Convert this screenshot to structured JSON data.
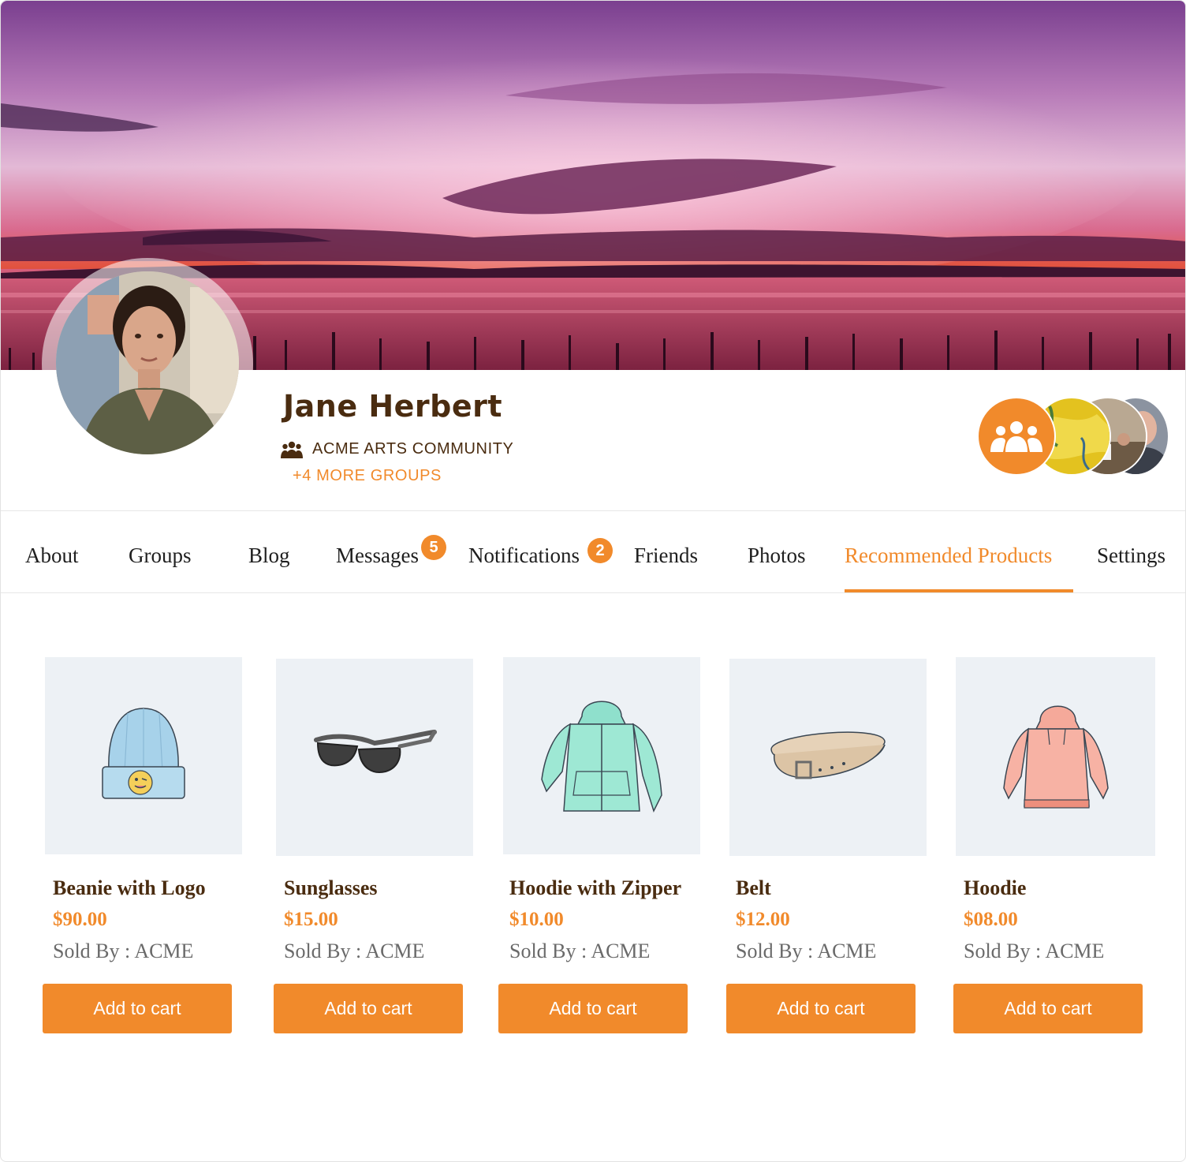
{
  "profile": {
    "name": "Jane Herbert",
    "group": "ACME ARTS COMMUNITY",
    "more_groups": "+4 MORE GROUPS"
  },
  "tabs": [
    {
      "label": "About"
    },
    {
      "label": "Groups"
    },
    {
      "label": "Blog"
    },
    {
      "label": "Messages",
      "badge": "5"
    },
    {
      "label": "Notifications",
      "badge": "2"
    },
    {
      "label": "Friends"
    },
    {
      "label": "Photos"
    },
    {
      "label": "Recommended Products",
      "active": true
    },
    {
      "label": "Settings"
    }
  ],
  "products": [
    {
      "name": "Beanie with Logo",
      "price": "$90.00",
      "seller": "Sold By : ACME",
      "button": "Add to cart",
      "icon": "beanie-icon"
    },
    {
      "name": "Sunglasses",
      "price": "$15.00",
      "seller": "Sold By : ACME",
      "button": "Add to cart",
      "icon": "sunglasses-icon"
    },
    {
      "name": "Hoodie with Zipper",
      "price": "$10.00",
      "seller": "Sold By : ACME",
      "button": "Add to cart",
      "icon": "zip-hoodie-icon"
    },
    {
      "name": "Belt",
      "price": "$12.00",
      "seller": "Sold By : ACME",
      "button": "Add to cart",
      "icon": "belt-icon"
    },
    {
      "name": "Hoodie",
      "price": "$08.00",
      "seller": "Sold By : ACME",
      "button": "Add to cart",
      "icon": "hoodie-icon"
    }
  ],
  "colors": {
    "accent": "#f18a2b",
    "heading": "#4a2c10",
    "thumb_bg": "#edf1f5"
  }
}
